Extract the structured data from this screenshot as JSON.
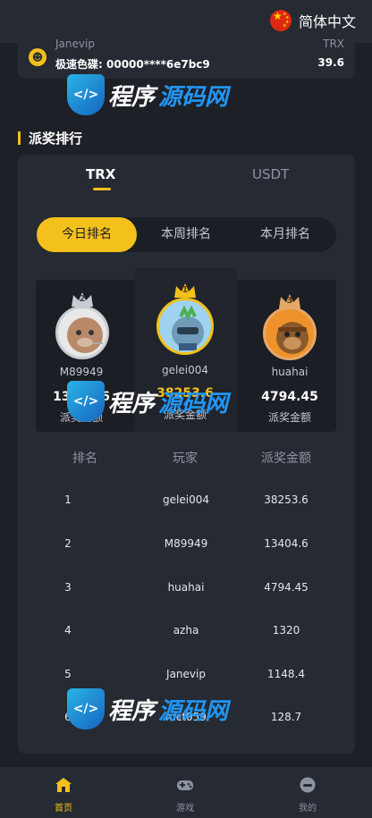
{
  "header": {
    "language": "简体中文"
  },
  "ticker": {
    "user": "Janevip",
    "coin": "TRX",
    "game": "极速色碟",
    "hash": "00000****6e7bc9",
    "amount": "39.6"
  },
  "section": {
    "title": "派奖排行"
  },
  "currency_tabs": [
    "TRX",
    "USDT"
  ],
  "period_tabs": [
    "今日排名",
    "本周排名",
    "本月排名"
  ],
  "podium": [
    {
      "rank": "2",
      "name": "M89949",
      "amount": "13404.6",
      "label": "派奖金额"
    },
    {
      "rank": "1",
      "name": "gelei004",
      "amount": "38253.6",
      "label": "派奖金额"
    },
    {
      "rank": "3",
      "name": "huahai",
      "amount": "4794.45",
      "label": "派奖金额"
    }
  ],
  "table": {
    "headers": [
      "排名",
      "玩家",
      "派奖金额"
    ],
    "rows": [
      {
        "rank": "1",
        "player": "gelei004",
        "amount": "38253.6"
      },
      {
        "rank": "2",
        "player": "M89949",
        "amount": "13404.6"
      },
      {
        "rank": "3",
        "player": "huahai",
        "amount": "4794.45"
      },
      {
        "rank": "4",
        "player": "azha",
        "amount": "1320"
      },
      {
        "rank": "5",
        "player": "Janevip",
        "amount": "1148.4"
      },
      {
        "rank": "6",
        "player": "mct059",
        "amount": "128.7"
      }
    ]
  },
  "watermark": {
    "part1": "程序",
    "part2": "源码网"
  },
  "nav": [
    "首页",
    "游戏",
    "我的"
  ],
  "colors": {
    "accent": "#f3c01c",
    "background": "#1d2027",
    "panel": "#262a33"
  }
}
